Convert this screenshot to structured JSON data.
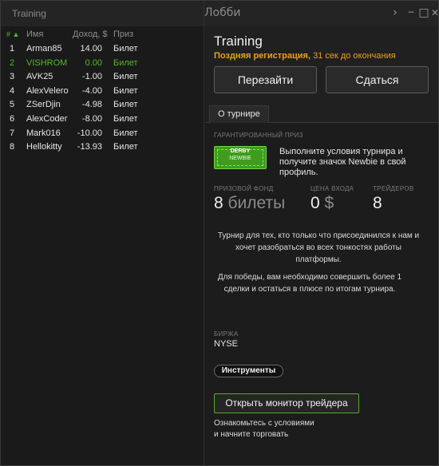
{
  "titlebar": {
    "left_title": "Training",
    "center_title": "Лобби",
    "btn_next": "›",
    "btn_min": "─",
    "btn_max": "□",
    "btn_close": "✕"
  },
  "leaderboard": {
    "sort_indicator": "# ▲",
    "headers": [
      "Имя",
      "Доход, $",
      "Приз"
    ],
    "rows": [
      {
        "rank": "1",
        "name": "Arman85",
        "profit": "14.00",
        "prize": "Билет",
        "highlight": false
      },
      {
        "rank": "2",
        "name": "VISHROM",
        "profit": "0.00",
        "prize": "Билет",
        "highlight": true
      },
      {
        "rank": "3",
        "name": "AVK25",
        "profit": "-1.00",
        "prize": "Билет",
        "highlight": false
      },
      {
        "rank": "4",
        "name": "AlexVelero",
        "profit": "-4.00",
        "prize": "Билет",
        "highlight": false
      },
      {
        "rank": "5",
        "name": "ZSerDjin",
        "profit": "-4.98",
        "prize": "Билет",
        "highlight": false
      },
      {
        "rank": "6",
        "name": "AlexCoder",
        "profit": "-8.00",
        "prize": "Билет",
        "highlight": false
      },
      {
        "rank": "7",
        "name": "Mark016",
        "profit": "-10.00",
        "prize": "Билет",
        "highlight": false
      },
      {
        "rank": "8",
        "name": "Hellokitty",
        "profit": "-13.93",
        "prize": "Билет",
        "highlight": false
      }
    ]
  },
  "tournament": {
    "title": "Training",
    "late_reg_label": "Поздняя регистрация,",
    "late_reg_time": "31 сек до окончания",
    "rejoin_label": "Перезайти",
    "surrender_label": "Сдаться",
    "tab_about": "О турнире",
    "guaranteed_label": "ГАРАНТИРОВАННЫЙ ПРИЗ",
    "badge_line1": "DERBY",
    "badge_line2": "NEWBIE",
    "guaranteed_text": "Выполните условия турнира и получите значок Newbie в свой профиль.",
    "prize_fund_label": "ПРИЗОВОЙ ФОНД",
    "prize_fund_value": "8",
    "prize_fund_unit": "билеты",
    "entry_label": "ЦЕНА ВХОДА",
    "entry_value": "0",
    "entry_unit": "$",
    "traders_label": "ТРЕЙДЕРОВ",
    "traders_value": "8",
    "description": "Турнир для тех, кто только что присоединился к нам и хочет разобраться во всех тонкостях работы платформы.",
    "win_condition": "Для победы, вам необходимо совершить более 1 сделки и остаться в плюсе по итогам турнира.",
    "exchange_label": "БИРЖА",
    "exchange_value": "NYSE",
    "instruments_label": "Инструменты",
    "open_monitor_label": "Открыть монитор трейдера",
    "note_line1": "Ознакомьтесь с условиями",
    "note_line2": "и начните торговать"
  },
  "colors": {
    "accent_green": "#58b52c",
    "late_orange": "#e8a020"
  }
}
